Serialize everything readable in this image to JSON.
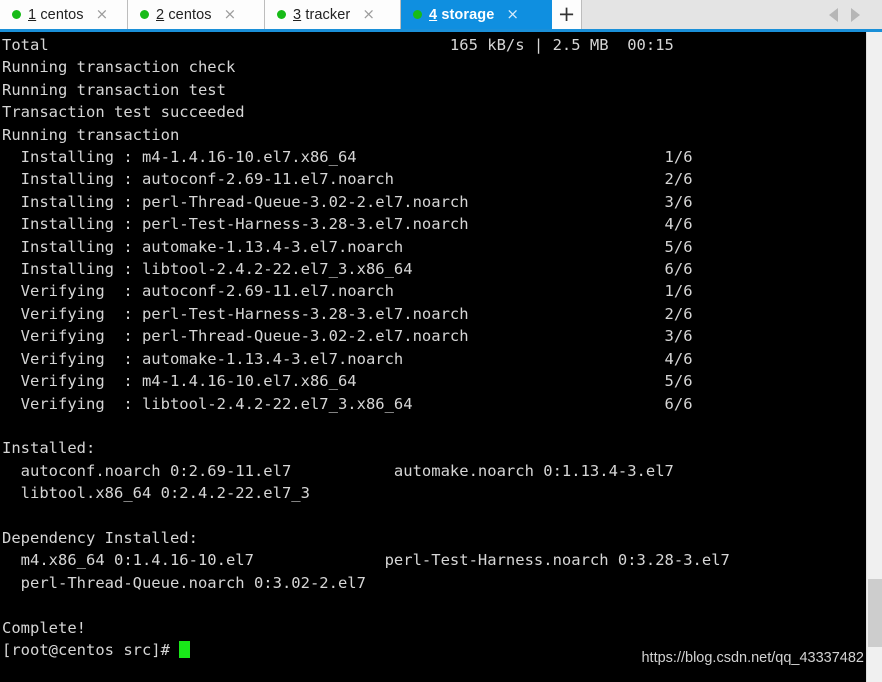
{
  "window": {
    "accent_color": "#0f8fe0",
    "tabbar_bg": "#e4e4e4",
    "terminal_bg": "#000000",
    "terminal_fg": "#d6d6d6",
    "cursor_color": "#19e819",
    "status_dot_color": "#18bb18"
  },
  "tabbar": {
    "tabs": [
      {
        "number": "1",
        "name": "centos",
        "label": "1 centos",
        "active": false,
        "close_label": "×",
        "status": "connected"
      },
      {
        "number": "2",
        "name": "centos",
        "label": "2 centos",
        "active": false,
        "close_label": "×",
        "status": "connected"
      },
      {
        "number": "3",
        "name": "tracker",
        "label": "3 tracker",
        "active": false,
        "close_label": "×",
        "status": "connected"
      },
      {
        "number": "4",
        "name": "storage",
        "label": "4 storage",
        "active": true,
        "close_label": "×",
        "status": "connected"
      }
    ],
    "new_tab_label": "+",
    "scroll_left_label": "◀",
    "scroll_right_label": "▶"
  },
  "terminal": {
    "total_line": {
      "label": "Total",
      "speed": "165 kB/s",
      "separator": "|",
      "size": "2.5 MB",
      "elapsed": "00:15"
    },
    "lines": [
      "Total                                           165 kB/s | 2.5 MB  00:15",
      "Running transaction check",
      "Running transaction test",
      "Transaction test succeeded",
      "Running transaction",
      "  Installing : m4-1.4.16-10.el7.x86_64                                 1/6",
      "  Installing : autoconf-2.69-11.el7.noarch                             2/6",
      "  Installing : perl-Thread-Queue-3.02-2.el7.noarch                     3/6",
      "  Installing : perl-Test-Harness-3.28-3.el7.noarch                     4/6",
      "  Installing : automake-1.13.4-3.el7.noarch                            5/6",
      "  Installing : libtool-2.4.2-22.el7_3.x86_64                           6/6",
      "  Verifying  : autoconf-2.69-11.el7.noarch                             1/6",
      "  Verifying  : perl-Test-Harness-3.28-3.el7.noarch                     2/6",
      "  Verifying  : perl-Thread-Queue-3.02-2.el7.noarch                     3/6",
      "  Verifying  : automake-1.13.4-3.el7.noarch                            4/6",
      "  Verifying  : m4-1.4.16-10.el7.x86_64                                 5/6",
      "  Verifying  : libtool-2.4.2-22.el7_3.x86_64                           6/6",
      "",
      "Installed:",
      "  autoconf.noarch 0:2.69-11.el7           automake.noarch 0:1.13.4-3.el7",
      "  libtool.x86_64 0:2.4.2-22.el7_3",
      "",
      "Dependency Installed:",
      "  m4.x86_64 0:1.4.16-10.el7              perl-Test-Harness.noarch 0:3.28-3.el7",
      "  perl-Thread-Queue.noarch 0:3.02-2.el7",
      "",
      "Complete!"
    ],
    "installing_steps": [
      {
        "action": "Installing",
        "package": "m4-1.4.16-10.el7.x86_64",
        "progress": "1/6"
      },
      {
        "action": "Installing",
        "package": "autoconf-2.69-11.el7.noarch",
        "progress": "2/6"
      },
      {
        "action": "Installing",
        "package": "perl-Thread-Queue-3.02-2.el7.noarch",
        "progress": "3/6"
      },
      {
        "action": "Installing",
        "package": "perl-Test-Harness-3.28-3.el7.noarch",
        "progress": "4/6"
      },
      {
        "action": "Installing",
        "package": "automake-1.13.4-3.el7.noarch",
        "progress": "5/6"
      },
      {
        "action": "Installing",
        "package": "libtool-2.4.2-22.el7_3.x86_64",
        "progress": "6/6"
      },
      {
        "action": "Verifying",
        "package": "autoconf-2.69-11.el7.noarch",
        "progress": "1/6"
      },
      {
        "action": "Verifying",
        "package": "perl-Test-Harness-3.28-3.el7.noarch",
        "progress": "2/6"
      },
      {
        "action": "Verifying",
        "package": "perl-Thread-Queue-3.02-2.el7.noarch",
        "progress": "3/6"
      },
      {
        "action": "Verifying",
        "package": "automake-1.13.4-3.el7.noarch",
        "progress": "4/6"
      },
      {
        "action": "Verifying",
        "package": "m4-1.4.16-10.el7.x86_64",
        "progress": "5/6"
      },
      {
        "action": "Verifying",
        "package": "libtool-2.4.2-22.el7_3.x86_64",
        "progress": "6/6"
      }
    ],
    "installed_header": "Installed:",
    "installed_packages": [
      "autoconf.noarch 0:2.69-11.el7",
      "automake.noarch 0:1.13.4-3.el7",
      "libtool.x86_64 0:2.4.2-22.el7_3"
    ],
    "dependency_header": "Dependency Installed:",
    "dependency_packages": [
      "m4.x86_64 0:1.4.16-10.el7",
      "perl-Test-Harness.noarch 0:3.28-3.el7",
      "perl-Thread-Queue.noarch 0:3.02-2.el7"
    ],
    "complete_message": "Complete!",
    "prompt": "[root@centos src]#"
  },
  "watermark": {
    "text": "https://blog.csdn.net/qq_43337482"
  }
}
